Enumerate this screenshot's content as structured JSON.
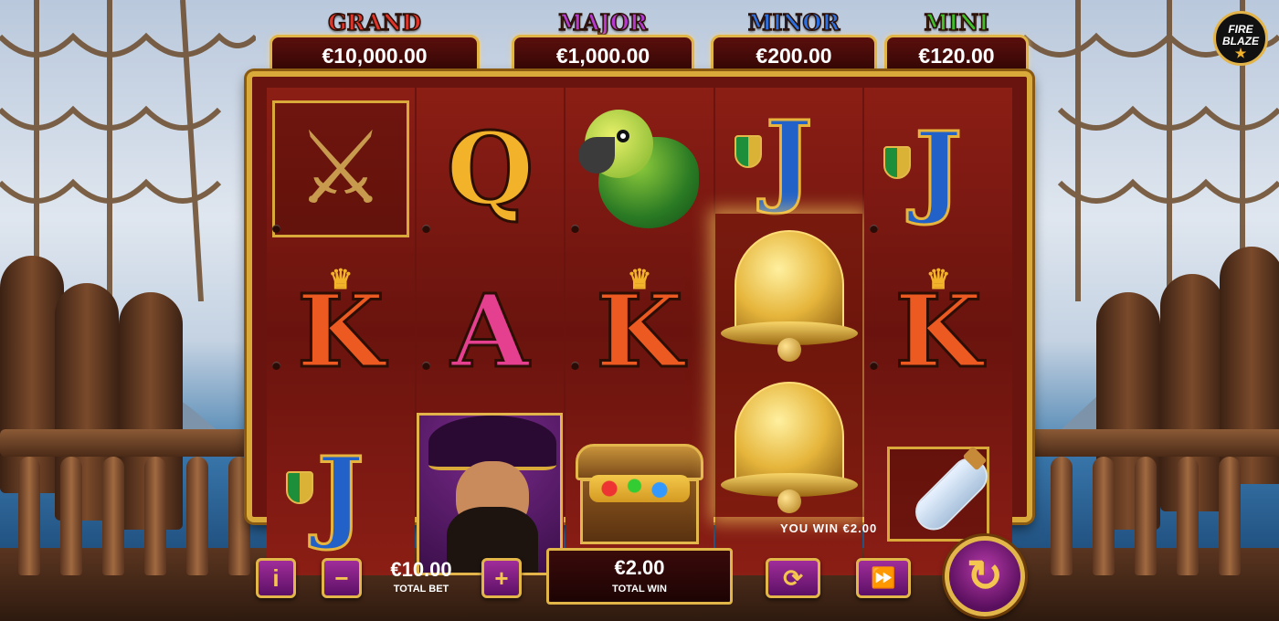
{
  "jackpots": [
    {
      "name": "GRAND",
      "value": "€10,000.00",
      "color": "#e0342a"
    },
    {
      "name": "MAJOR",
      "value": "€1,000.00",
      "color": "#b43ad0"
    },
    {
      "name": "MINOR",
      "value": "€200.00",
      "color": "#2c6fe0"
    },
    {
      "name": "MINI",
      "value": "€120.00",
      "color": "#3fbf2a"
    }
  ],
  "logo": {
    "line1": "FIRE",
    "line2": "BLAZE",
    "star": "★"
  },
  "reels": [
    [
      "crossed-pistols",
      "K",
      "J"
    ],
    [
      "Q",
      "A",
      "pirate-captain"
    ],
    [
      "parrot",
      "K",
      "treasure-chest"
    ],
    [
      "J",
      "bell",
      "bell"
    ],
    [
      "J",
      "K",
      "message-bottle"
    ]
  ],
  "symbols": {
    "q": "Q",
    "k": "K",
    "a": "A",
    "j": "J",
    "crown": "♛",
    "pistols": "⚔"
  },
  "win_message": "YOU WIN €2.00",
  "controls": {
    "info_label": "i",
    "minus_label": "−",
    "plus_label": "+",
    "total_bet_value": "€10.00",
    "total_bet_label": "TOTAL BET",
    "total_win_value": "€2.00",
    "total_win_label": "TOTAL WIN",
    "autoplay_icon": "⟳",
    "turbo_icon": "⏩",
    "spin_icon": "↻"
  }
}
